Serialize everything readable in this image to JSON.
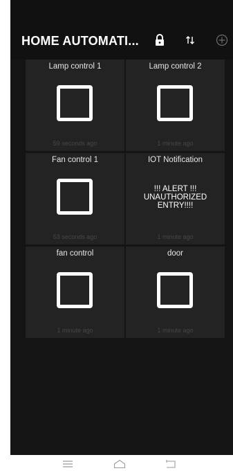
{
  "app": {
    "title": "HOME AUTOMATI..."
  },
  "toolbar": {
    "icons": [
      "lock-icon",
      "sort-arrows-icon",
      "add-circle-icon"
    ]
  },
  "tiles": [
    {
      "title": "Lamp control 1",
      "type": "toggle",
      "time": "59 seconds ago"
    },
    {
      "title": "Lamp control 2",
      "type": "toggle",
      "time": "1 minute ago"
    },
    {
      "title": "Fan control 1",
      "type": "toggle",
      "time": "53 seconds ago"
    },
    {
      "title": "IOT Notification",
      "type": "text",
      "lines": [
        "!!! ALERT !!!",
        "UNAUTHORIZED",
        "ENTRY!!!!"
      ],
      "time": "1 minute ago"
    },
    {
      "title": "fan control",
      "type": "toggle",
      "time": "1 minute ago"
    },
    {
      "title": "door",
      "type": "toggle",
      "time": "1 minute ago"
    }
  ],
  "navbar": {
    "icons": [
      "menu-icon",
      "home-icon",
      "back-icon"
    ]
  },
  "colors": {
    "background": "#141414",
    "tile": "#232323",
    "text": "#ffffff",
    "muted": "#474747"
  }
}
